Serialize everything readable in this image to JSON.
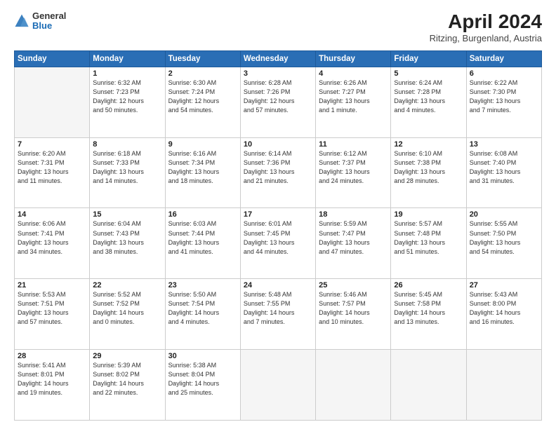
{
  "logo": {
    "general": "General",
    "blue": "Blue"
  },
  "title": "April 2024",
  "subtitle": "Ritzing, Burgenland, Austria",
  "days": [
    "Sunday",
    "Monday",
    "Tuesday",
    "Wednesday",
    "Thursday",
    "Friday",
    "Saturday"
  ],
  "weeks": [
    [
      {
        "num": "",
        "lines": []
      },
      {
        "num": "1",
        "lines": [
          "Sunrise: 6:32 AM",
          "Sunset: 7:23 PM",
          "Daylight: 12 hours",
          "and 50 minutes."
        ]
      },
      {
        "num": "2",
        "lines": [
          "Sunrise: 6:30 AM",
          "Sunset: 7:24 PM",
          "Daylight: 12 hours",
          "and 54 minutes."
        ]
      },
      {
        "num": "3",
        "lines": [
          "Sunrise: 6:28 AM",
          "Sunset: 7:26 PM",
          "Daylight: 12 hours",
          "and 57 minutes."
        ]
      },
      {
        "num": "4",
        "lines": [
          "Sunrise: 6:26 AM",
          "Sunset: 7:27 PM",
          "Daylight: 13 hours",
          "and 1 minute."
        ]
      },
      {
        "num": "5",
        "lines": [
          "Sunrise: 6:24 AM",
          "Sunset: 7:28 PM",
          "Daylight: 13 hours",
          "and 4 minutes."
        ]
      },
      {
        "num": "6",
        "lines": [
          "Sunrise: 6:22 AM",
          "Sunset: 7:30 PM",
          "Daylight: 13 hours",
          "and 7 minutes."
        ]
      }
    ],
    [
      {
        "num": "7",
        "lines": [
          "Sunrise: 6:20 AM",
          "Sunset: 7:31 PM",
          "Daylight: 13 hours",
          "and 11 minutes."
        ]
      },
      {
        "num": "8",
        "lines": [
          "Sunrise: 6:18 AM",
          "Sunset: 7:33 PM",
          "Daylight: 13 hours",
          "and 14 minutes."
        ]
      },
      {
        "num": "9",
        "lines": [
          "Sunrise: 6:16 AM",
          "Sunset: 7:34 PM",
          "Daylight: 13 hours",
          "and 18 minutes."
        ]
      },
      {
        "num": "10",
        "lines": [
          "Sunrise: 6:14 AM",
          "Sunset: 7:36 PM",
          "Daylight: 13 hours",
          "and 21 minutes."
        ]
      },
      {
        "num": "11",
        "lines": [
          "Sunrise: 6:12 AM",
          "Sunset: 7:37 PM",
          "Daylight: 13 hours",
          "and 24 minutes."
        ]
      },
      {
        "num": "12",
        "lines": [
          "Sunrise: 6:10 AM",
          "Sunset: 7:38 PM",
          "Daylight: 13 hours",
          "and 28 minutes."
        ]
      },
      {
        "num": "13",
        "lines": [
          "Sunrise: 6:08 AM",
          "Sunset: 7:40 PM",
          "Daylight: 13 hours",
          "and 31 minutes."
        ]
      }
    ],
    [
      {
        "num": "14",
        "lines": [
          "Sunrise: 6:06 AM",
          "Sunset: 7:41 PM",
          "Daylight: 13 hours",
          "and 34 minutes."
        ]
      },
      {
        "num": "15",
        "lines": [
          "Sunrise: 6:04 AM",
          "Sunset: 7:43 PM",
          "Daylight: 13 hours",
          "and 38 minutes."
        ]
      },
      {
        "num": "16",
        "lines": [
          "Sunrise: 6:03 AM",
          "Sunset: 7:44 PM",
          "Daylight: 13 hours",
          "and 41 minutes."
        ]
      },
      {
        "num": "17",
        "lines": [
          "Sunrise: 6:01 AM",
          "Sunset: 7:45 PM",
          "Daylight: 13 hours",
          "and 44 minutes."
        ]
      },
      {
        "num": "18",
        "lines": [
          "Sunrise: 5:59 AM",
          "Sunset: 7:47 PM",
          "Daylight: 13 hours",
          "and 47 minutes."
        ]
      },
      {
        "num": "19",
        "lines": [
          "Sunrise: 5:57 AM",
          "Sunset: 7:48 PM",
          "Daylight: 13 hours",
          "and 51 minutes."
        ]
      },
      {
        "num": "20",
        "lines": [
          "Sunrise: 5:55 AM",
          "Sunset: 7:50 PM",
          "Daylight: 13 hours",
          "and 54 minutes."
        ]
      }
    ],
    [
      {
        "num": "21",
        "lines": [
          "Sunrise: 5:53 AM",
          "Sunset: 7:51 PM",
          "Daylight: 13 hours",
          "and 57 minutes."
        ]
      },
      {
        "num": "22",
        "lines": [
          "Sunrise: 5:52 AM",
          "Sunset: 7:52 PM",
          "Daylight: 14 hours",
          "and 0 minutes."
        ]
      },
      {
        "num": "23",
        "lines": [
          "Sunrise: 5:50 AM",
          "Sunset: 7:54 PM",
          "Daylight: 14 hours",
          "and 4 minutes."
        ]
      },
      {
        "num": "24",
        "lines": [
          "Sunrise: 5:48 AM",
          "Sunset: 7:55 PM",
          "Daylight: 14 hours",
          "and 7 minutes."
        ]
      },
      {
        "num": "25",
        "lines": [
          "Sunrise: 5:46 AM",
          "Sunset: 7:57 PM",
          "Daylight: 14 hours",
          "and 10 minutes."
        ]
      },
      {
        "num": "26",
        "lines": [
          "Sunrise: 5:45 AM",
          "Sunset: 7:58 PM",
          "Daylight: 14 hours",
          "and 13 minutes."
        ]
      },
      {
        "num": "27",
        "lines": [
          "Sunrise: 5:43 AM",
          "Sunset: 8:00 PM",
          "Daylight: 14 hours",
          "and 16 minutes."
        ]
      }
    ],
    [
      {
        "num": "28",
        "lines": [
          "Sunrise: 5:41 AM",
          "Sunset: 8:01 PM",
          "Daylight: 14 hours",
          "and 19 minutes."
        ]
      },
      {
        "num": "29",
        "lines": [
          "Sunrise: 5:39 AM",
          "Sunset: 8:02 PM",
          "Daylight: 14 hours",
          "and 22 minutes."
        ]
      },
      {
        "num": "30",
        "lines": [
          "Sunrise: 5:38 AM",
          "Sunset: 8:04 PM",
          "Daylight: 14 hours",
          "and 25 minutes."
        ]
      },
      {
        "num": "",
        "lines": []
      },
      {
        "num": "",
        "lines": []
      },
      {
        "num": "",
        "lines": []
      },
      {
        "num": "",
        "lines": []
      }
    ]
  ]
}
